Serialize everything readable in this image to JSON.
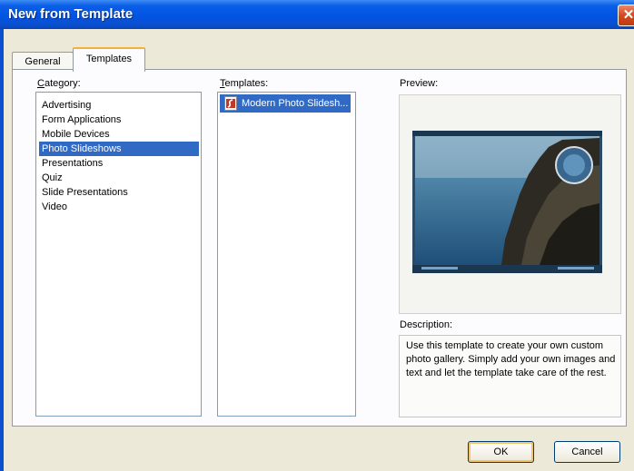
{
  "window": {
    "title": "New from Template"
  },
  "tabs": [
    {
      "label": "General"
    },
    {
      "label": "Templates"
    }
  ],
  "category": {
    "label": "Category:",
    "items": [
      "Advertising",
      "Form Applications",
      "Mobile Devices",
      "Photo Slideshows",
      "Presentations",
      "Quiz",
      "Slide Presentations",
      "Video"
    ],
    "selected": "Photo Slideshows"
  },
  "templates": {
    "label": "Templates:",
    "items": [
      "Modern Photo Slidesh..."
    ],
    "selected": "Modern Photo Slidesh..."
  },
  "preview": {
    "label": "Preview:"
  },
  "description": {
    "label": "Description:",
    "text": "Use this template to create your own custom photo gallery. Simply add your own images and text and let the template take care of the rest."
  },
  "buttons": {
    "ok": "OK",
    "cancel": "Cancel"
  },
  "icons": {
    "close": "close-icon",
    "template": "flash-template-icon"
  }
}
